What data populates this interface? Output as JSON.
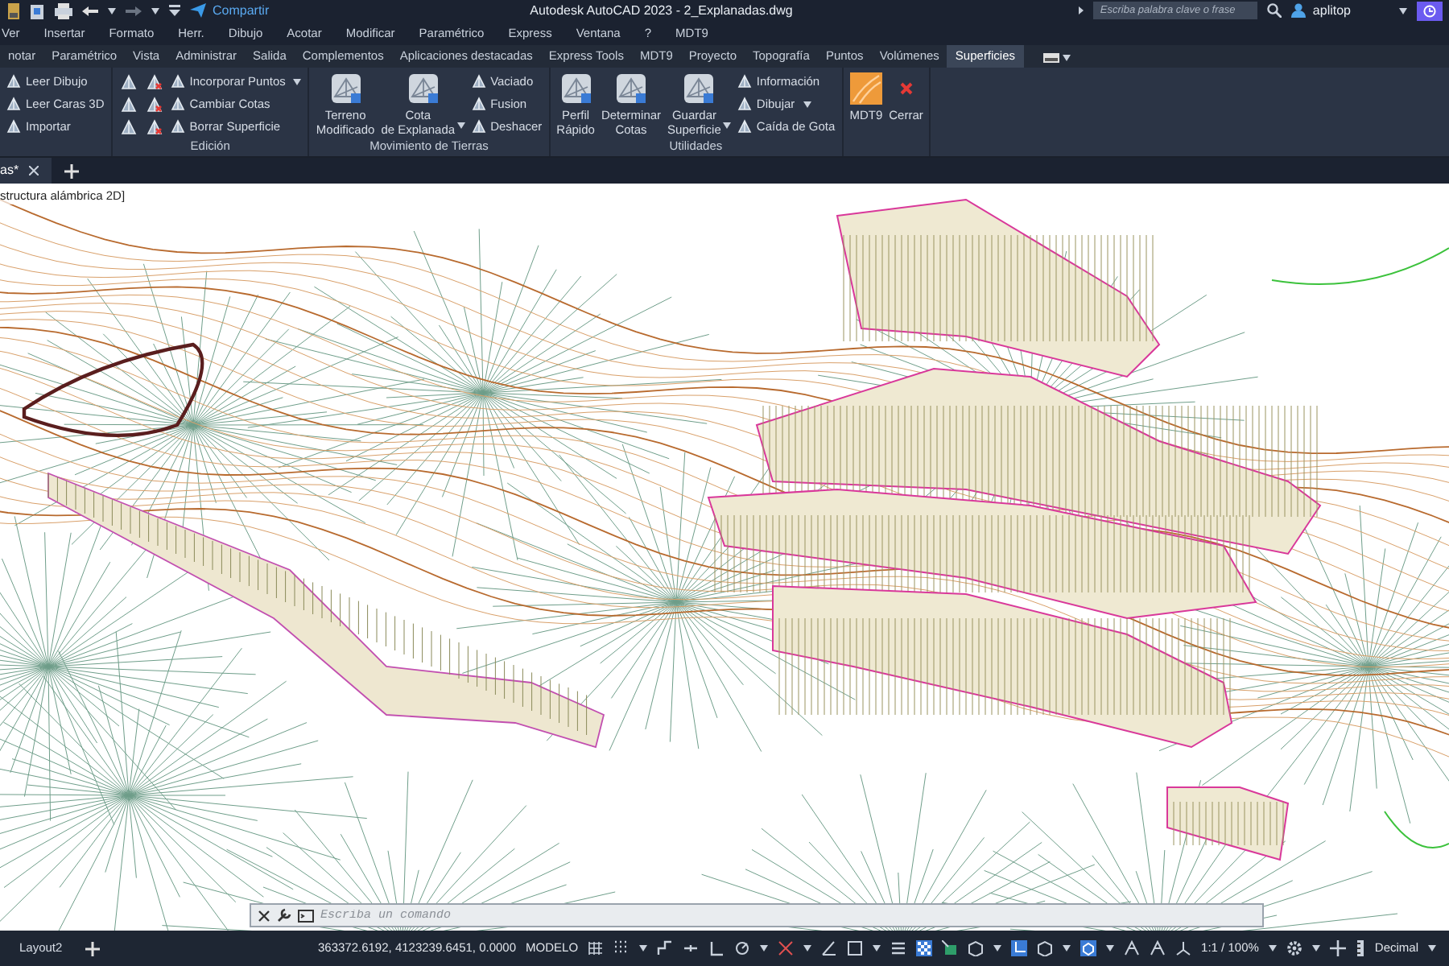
{
  "title_bar": {
    "share": "Compartir",
    "title": "Autodesk AutoCAD 2023 - 2_Explanadas.dwg",
    "search": {
      "placeholder": "Escriba palabra clave o frase"
    },
    "user": "aplitop"
  },
  "menu_bar": [
    "Ver",
    "Insertar",
    "Formato",
    "Herr.",
    "Dibujo",
    "Acotar",
    "Modificar",
    "Paramétrico",
    "Express",
    "Ventana",
    "?",
    "MDT9"
  ],
  "ribbon_tabs": [
    {
      "label": "notar",
      "selected": false
    },
    {
      "label": "Paramétrico",
      "selected": false
    },
    {
      "label": "Vista",
      "selected": false
    },
    {
      "label": "Administrar",
      "selected": false
    },
    {
      "label": "Salida",
      "selected": false
    },
    {
      "label": "Complementos",
      "selected": false
    },
    {
      "label": "Aplicaciones destacadas",
      "selected": false
    },
    {
      "label": "Express Tools",
      "selected": false
    },
    {
      "label": "MDT9",
      "selected": false
    },
    {
      "label": "Proyecto",
      "selected": false
    },
    {
      "label": "Topografía",
      "selected": false
    },
    {
      "label": "Puntos",
      "selected": false
    },
    {
      "label": "Volúmenes",
      "selected": false
    },
    {
      "label": "Superficies",
      "selected": true
    }
  ],
  "ribbon_panels": [
    {
      "columns": [
        [
          {
            "kind": "small",
            "label": "Leer Dibujo",
            "dropdown": false
          },
          {
            "kind": "small",
            "label": "Leer Caras 3D",
            "dropdown": false
          },
          {
            "kind": "small",
            "label": "Importar",
            "dropdown": false
          }
        ]
      ]
    },
    {
      "title": "Edición",
      "columns": [
        [
          {
            "kind": "icon"
          },
          {
            "kind": "icon"
          },
          {
            "kind": "icon"
          }
        ],
        [
          {
            "kind": "icon"
          },
          {
            "kind": "icon"
          },
          {
            "kind": "icon"
          }
        ],
        [
          {
            "kind": "small",
            "label": "Incorporar Puntos",
            "dropdown": true
          },
          {
            "kind": "small",
            "label": "Cambiar Cotas",
            "dropdown": false
          },
          {
            "kind": "small",
            "label": "Borrar Superficie",
            "dropdown": false
          }
        ]
      ]
    },
    {
      "title": "Movimiento de Tierras",
      "columns": [
        [
          {
            "kind": "large",
            "lines": [
              "Terreno",
              "Modificado"
            ],
            "dropdown": false
          }
        ],
        [
          {
            "kind": "large",
            "lines": [
              "Cota",
              "de Explanada"
            ],
            "dropdown": true
          }
        ],
        [
          {
            "kind": "small",
            "label": "Vaciado",
            "dropdown": false
          },
          {
            "kind": "small",
            "label": "Fusion",
            "dropdown": false
          },
          {
            "kind": "small",
            "label": "Deshacer",
            "dropdown": false
          }
        ]
      ]
    },
    {
      "title": "Utilidades",
      "columns": [
        [
          {
            "kind": "large",
            "lines": [
              "Perfil",
              "Rápido"
            ],
            "dropdown": false
          }
        ],
        [
          {
            "kind": "large",
            "lines": [
              "Determinar",
              "Cotas"
            ],
            "dropdown": false
          }
        ],
        [
          {
            "kind": "large",
            "lines": [
              "Guardar",
              "Superficie"
            ],
            "dropdown": true
          }
        ],
        [
          {
            "kind": "small",
            "label": "Información",
            "dropdown": false
          },
          {
            "kind": "small",
            "label": "Dibujar",
            "dropdown": true
          },
          {
            "kind": "small",
            "label": "Caída de Gota",
            "dropdown": false
          }
        ]
      ]
    },
    {
      "columns": [
        [
          {
            "kind": "logo",
            "lines": [
              "MDT9"
            ],
            "dropdown": false
          }
        ],
        [
          {
            "kind": "close",
            "lines": [
              "Cerrar"
            ],
            "dropdown": false
          }
        ]
      ]
    }
  ],
  "file_tabs": [
    {
      "label": "as*",
      "selected": true
    }
  ],
  "viewport": {
    "label": "structura alámbrica 2D]"
  },
  "command_line": {
    "placeholder": "Escriba un comando"
  },
  "status_bar": {
    "layouts": [
      {
        "label": "Layout2",
        "selected": false
      }
    ],
    "coordinates": "363372.6192, 4123239.6451, 0.0000",
    "space": "MODELO",
    "scale": "1:1 / 100%",
    "units": "Decimal"
  }
}
